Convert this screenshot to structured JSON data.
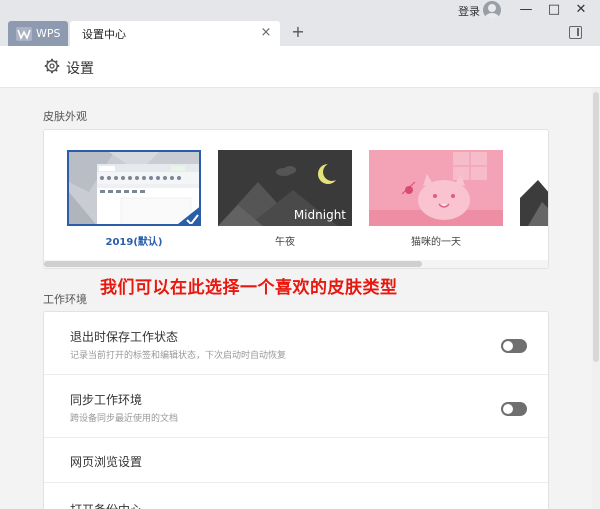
{
  "titlebar": {
    "wps_tab_label": "WPS",
    "active_tab_label": "设置中心",
    "tab_close_glyph": "×",
    "new_tab_glyph": "+",
    "login_label": "登录",
    "minimize_glyph": "—",
    "maximize_glyph": "□",
    "close_glyph": "✕"
  },
  "header": {
    "title": "设置",
    "icon": "gear-icon"
  },
  "skin_section": {
    "label": "皮肤外观",
    "skins": [
      {
        "name": "2019(默认)",
        "selected": true
      },
      {
        "name": "午夜",
        "overlay_text": "Midnight",
        "selected": false
      },
      {
        "name": "猫咪的一天",
        "selected": false
      }
    ]
  },
  "annotation": "我们可以在此选择一个喜欢的皮肤类型",
  "env_section": {
    "label": "工作环境",
    "rows": [
      {
        "title": "退出时保存工作状态",
        "subtitle": "记录当前打开的标签和编辑状态，下次启动时自动恢复",
        "toggle": false
      },
      {
        "title": "同步工作环境",
        "subtitle": "跨设备同步最近使用的文档",
        "toggle": false
      },
      {
        "title": "网页浏览设置"
      },
      {
        "title": "打开备份中心"
      }
    ]
  },
  "colors": {
    "accent": "#2a5ea8",
    "annotation": "#e8180f",
    "toggle_off": "#6f6f6f"
  }
}
